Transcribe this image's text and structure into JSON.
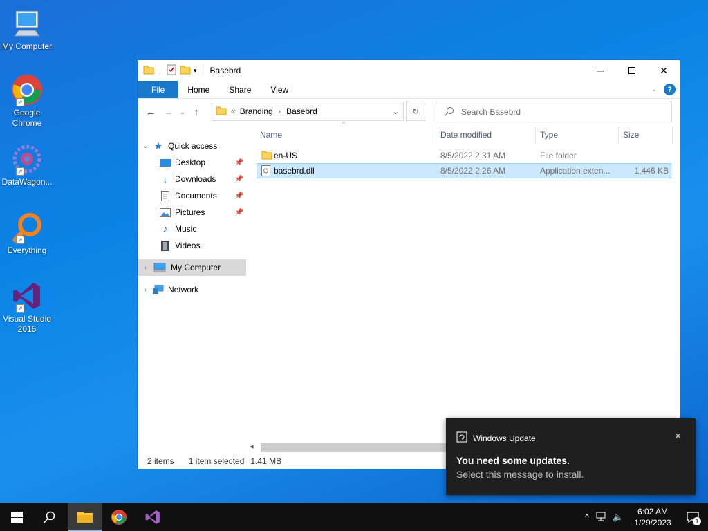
{
  "desktop": {
    "icons": [
      {
        "label": "My Computer",
        "icon": "computer-icon"
      },
      {
        "label": "Google Chrome",
        "icon": "chrome-icon"
      },
      {
        "label": "DataWagon...",
        "icon": "datawagon-icon"
      },
      {
        "label": "Everything",
        "icon": "everything-icon"
      },
      {
        "label": "Visual Studio 2015",
        "icon": "visual-studio-icon"
      }
    ]
  },
  "window": {
    "title": "Basebrd",
    "ribbon_tabs": [
      "File",
      "Home",
      "Share",
      "View"
    ],
    "address": {
      "overflow": "«",
      "crumbs": [
        "Branding",
        "Basebrd"
      ]
    },
    "search_placeholder": "Search Basebrd",
    "nav": {
      "quick_access": "Quick access",
      "items": [
        {
          "label": "Desktop",
          "pinned": true
        },
        {
          "label": "Downloads",
          "pinned": true
        },
        {
          "label": "Documents",
          "pinned": true
        },
        {
          "label": "Pictures",
          "pinned": true
        },
        {
          "label": "Music",
          "pinned": false
        },
        {
          "label": "Videos",
          "pinned": false
        }
      ],
      "my_computer": "My Computer",
      "network": "Network"
    },
    "columns": [
      "Name",
      "Date modified",
      "Type",
      "Size"
    ],
    "files": [
      {
        "name": "en-US",
        "date": "8/5/2022 2:31 AM",
        "type": "File folder",
        "size": ""
      },
      {
        "name": "basebrd.dll",
        "date": "8/5/2022 2:26 AM",
        "type": "Application exten...",
        "size": "1,446 KB"
      }
    ],
    "status": {
      "items": "2 items",
      "selected": "1 item selected",
      "size": "1.41 MB"
    }
  },
  "toast": {
    "app": "Windows Update",
    "heading": "You need some updates.",
    "body": "Select this message to install."
  },
  "taskbar": {
    "time": "6:02 AM",
    "date": "1/29/2023",
    "notification_count": "1"
  },
  "colors": {
    "accent": "#1979ca",
    "selection": "#cce8ff",
    "desktop": "#0a84e6"
  }
}
